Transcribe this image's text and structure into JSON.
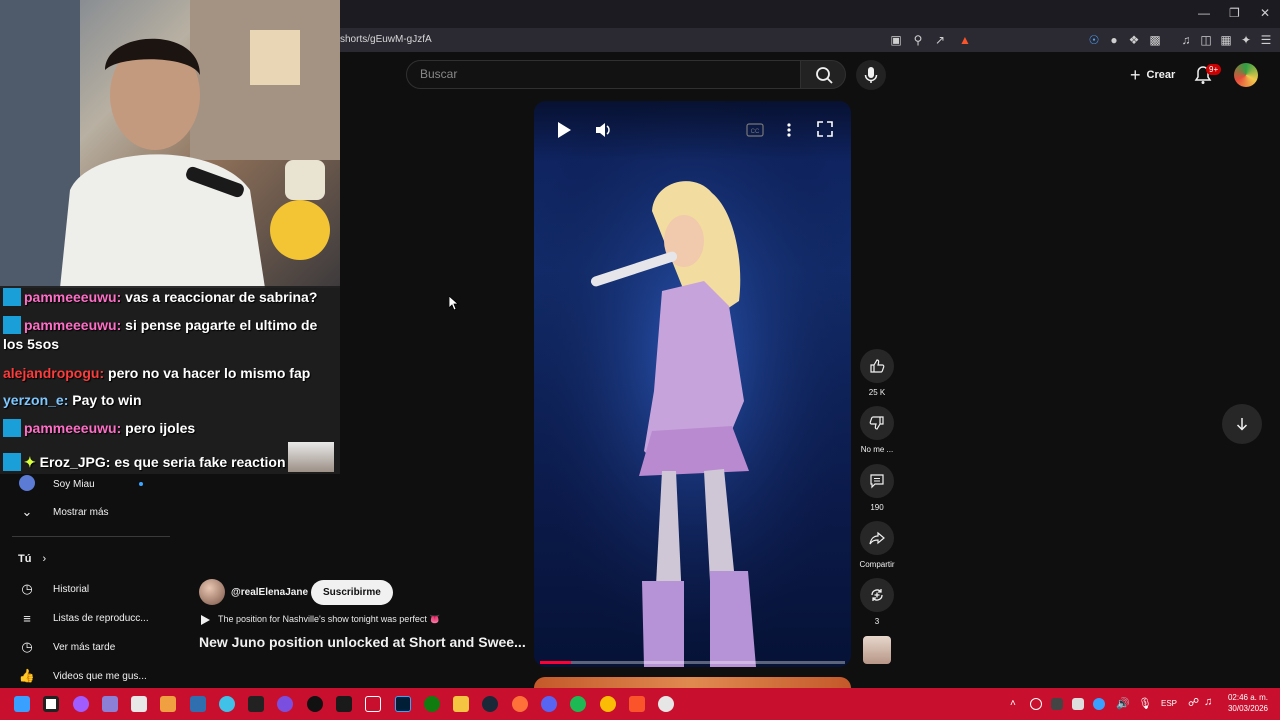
{
  "browser": {
    "url": "shorts/gEuwM-gJzfA"
  },
  "youtube": {
    "search": {
      "placeholder": "Buscar"
    },
    "header": {
      "create_label": "Crear",
      "notifications_badge": "9+"
    },
    "short": {
      "channel": "@realElenaJane",
      "subscribe_label": "Suscribirme",
      "caption": "The position for Nashville's show tonight was perfect 👅",
      "title": "New Juno position unlocked at Short and Swee...",
      "progress_fraction": 0.1,
      "actions": {
        "likes": "25 K",
        "dislike_label": "No me ...",
        "comments": "190",
        "share_label": "Compartir",
        "remix_count": "3"
      }
    },
    "sidebar": {
      "items_top": [
        {
          "label": "Soy Miau",
          "icon": "channel-avatar"
        },
        {
          "label": "Mostrar más",
          "icon": "chevron-down-icon"
        }
      ],
      "section_title": "Tú",
      "items_you": [
        {
          "label": "Historial",
          "icon": "history-icon"
        },
        {
          "label": "Listas de reproducc...",
          "icon": "playlist-icon"
        },
        {
          "label": "Ver más tarde",
          "icon": "clock-icon"
        },
        {
          "label": "Videos que me gus...",
          "icon": "thumb-up-icon"
        }
      ]
    }
  },
  "stream_chat": [
    {
      "user": "pammeeeuwu",
      "sep": ":",
      "text": "vas a reaccionar de sabrina?",
      "color": "#ff6ec7",
      "icon": true
    },
    {
      "user": "pammeeeuwu",
      "sep": ":",
      "text": "si pense pagarte el ultimo de",
      "color": "#ff6ec7",
      "icon": true
    },
    {
      "user": "",
      "sep": "",
      "text": "los 5sos",
      "color": "#fff",
      "icon": false
    },
    {
      "user": "alejandropogu",
      "sep": ":",
      "text": "pero no va hacer lo mismo fap",
      "color": "#ff3b3b",
      "icon": false
    },
    {
      "user": "yerzon_e",
      "sep": ":",
      "text": "Pay to win",
      "color": "#7ec8ff",
      "icon": false
    },
    {
      "user": "pammeeeuwu",
      "sep": ":",
      "text": "pero ijoles",
      "color": "#ff6ec7",
      "icon": true
    },
    {
      "user": "Eroz_JPG",
      "sep": ":",
      "text": "es que seria fake reaction",
      "color": "#fff",
      "icon": true
    }
  ],
  "taskbar": {
    "language": "ESP",
    "time": "02:46 a. m.",
    "date": "30/03/2026"
  },
  "colors": {
    "taskbar": "#c8102e",
    "yt_bg": "#0f0f0f",
    "progress": "#ff0033",
    "notif_badge": "#cc0000"
  }
}
